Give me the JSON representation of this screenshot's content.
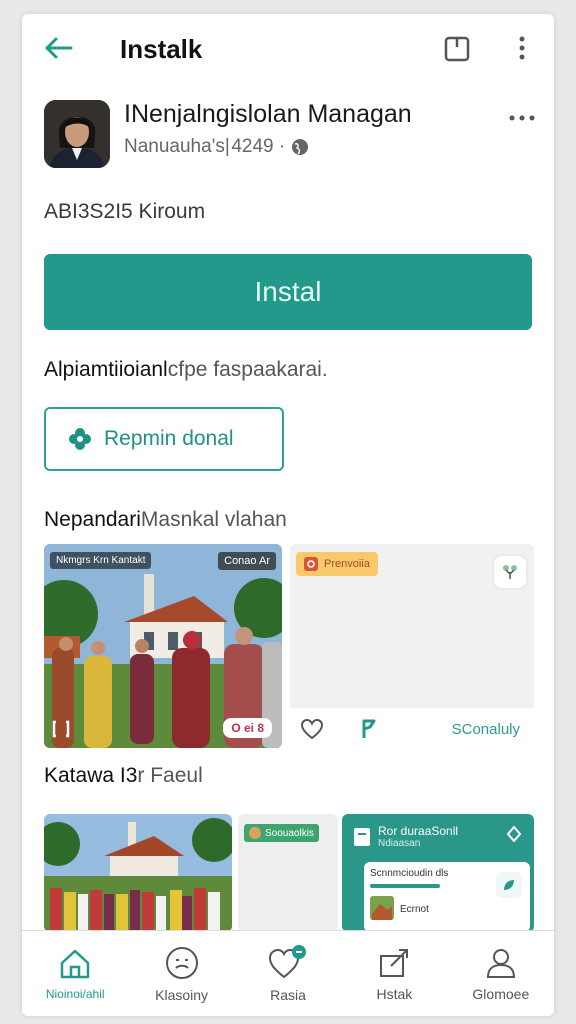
{
  "topbar": {
    "title": "Instalk"
  },
  "app": {
    "name": "INenjalngislolan Managan",
    "subtitle": "Nanuauha's| 4249 ·"
  },
  "rating_line": "ABI3S2I5 Kiroum",
  "install_label": "Instal",
  "description": {
    "strong": "Alpiamtiioianl",
    "soft": "cfpe faspaakarai."
  },
  "secondary_button": {
    "label": "Repmin donal"
  },
  "section_one": {
    "strong": "Nepandari",
    "soft": "Masnkal vlahan"
  },
  "screenshot_one": {
    "caption": "Nkmgrs Krn Kantakt",
    "tag": "Conao Ar",
    "badge": "O ei 8"
  },
  "screenshot_two": {
    "promo": "Prenvoiia",
    "link": "SConaluly"
  },
  "section_two": {
    "strong": "Katawa I3",
    "soft": "r Faeul"
  },
  "gallery": {
    "card2_tag": "Soouaolkis",
    "card3_title": "Ror duraaSonll",
    "card3_sub": "Ndiaasan",
    "card3_row1": "Scnnmcioudin dls",
    "card3_row2": "Ecrnot"
  },
  "nav": [
    {
      "label": "Nioinoi/ahil",
      "icon": "home-icon"
    },
    {
      "label": "Klasoiny",
      "icon": "face-icon"
    },
    {
      "label": "Rasia",
      "icon": "heart-badge-icon"
    },
    {
      "label": "Hstak",
      "icon": "share-box-icon"
    },
    {
      "label": "Glomoee",
      "icon": "user-icon"
    }
  ],
  "colors": {
    "accent": "#22998a",
    "accent_light": "#2aa394"
  }
}
